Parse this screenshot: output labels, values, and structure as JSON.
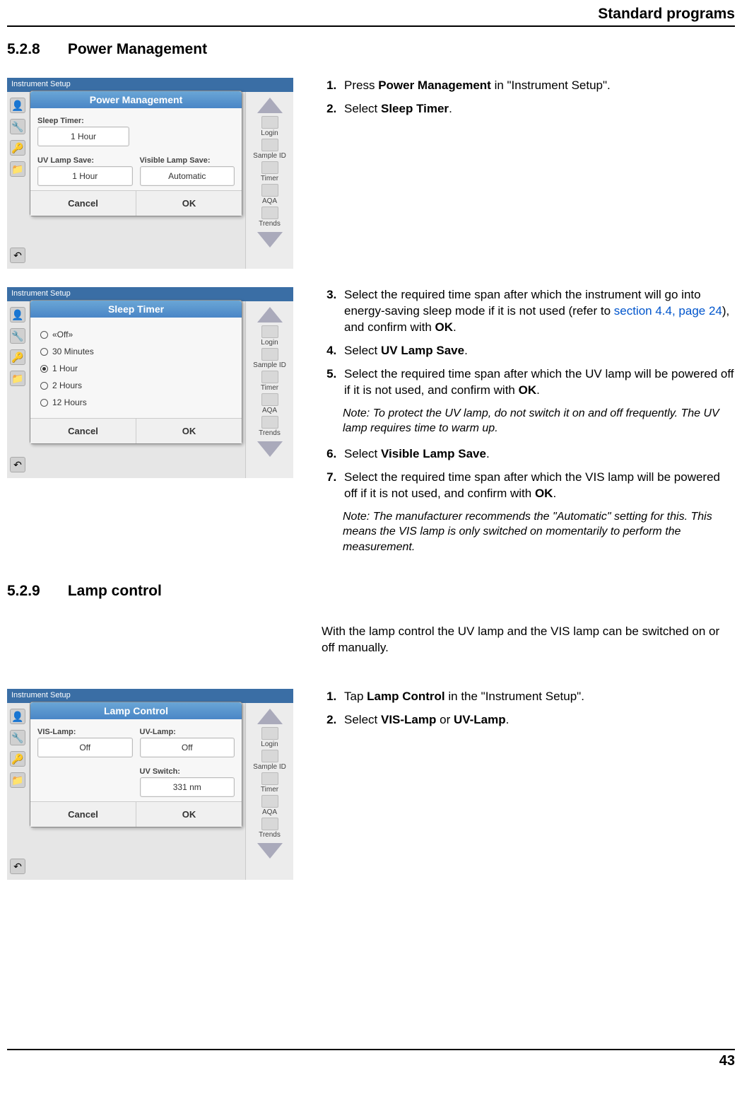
{
  "header": {
    "title": "Standard programs"
  },
  "sections": {
    "s1": {
      "num": "5.2.8",
      "title": "Power Management"
    },
    "s2": {
      "num": "5.2.9",
      "title": "Lamp control"
    }
  },
  "block1": {
    "steps": [
      {
        "pre": "Press ",
        "b": "Power Management",
        "post": " in \"Instrument Setup\"."
      },
      {
        "pre": "Select ",
        "b": "Sleep Timer",
        "post": "."
      }
    ]
  },
  "block2": {
    "step3_a": "Select the required time span after which the instrument will go into energy-saving sleep mode if it is not used (refer to ",
    "step3_link": "section 4.4, page 24",
    "step3_b": "), and confirm with ",
    "step3_bold": "OK",
    "step3_c": ".",
    "step4_pre": "Select ",
    "step4_b": "UV Lamp Save",
    "step4_post": ".",
    "step5_a": "Select the required time span after which the UV lamp will be powered off if it is not used, and confirm with ",
    "step5_b": "OK",
    "step5_c": ".",
    "note1": "Note: To protect the UV lamp, do not switch it on and off frequently. The UV lamp requires time to warm up.",
    "step6_pre": "Select ",
    "step6_b": "Visible Lamp Save",
    "step6_post": ".",
    "step7_a": "Select the required time span after which the VIS lamp will be powered off if it is not used, and confirm with ",
    "step7_b": "OK",
    "step7_c": ".",
    "note2": "Note: The manufacturer recommends the \"Automatic\" setting for this. This means the VIS lamp is only switched on momentarily to perform the measurement."
  },
  "intro2": "With the lamp control the UV lamp and the VIS lamp can be switched on or off manually.",
  "block3": {
    "step1_pre": "Tap ",
    "step1_b": "Lamp Control",
    "step1_post": " in the \"Instrument Setup\".",
    "step2_pre": "Select ",
    "step2_b1": "VIS-Lamp",
    "step2_mid": " or ",
    "step2_b2": "UV-Lamp",
    "step2_post": "."
  },
  "shot_common": {
    "bg_title": "Instrument Setup",
    "side_right": {
      "login": "Login",
      "sample": "Sample ID",
      "timer": "Timer",
      "aqa": "AQA",
      "trends": "Trends"
    },
    "cancel": "Cancel",
    "ok": "OK"
  },
  "shot1": {
    "title": "Power Management",
    "sleep_label": "Sleep Timer:",
    "sleep_val": "1 Hour",
    "uv_label": "UV Lamp Save:",
    "vis_label": "Visible Lamp Save:",
    "uv_val": "1 Hour",
    "vis_val": "Automatic"
  },
  "shot2": {
    "title": "Sleep Timer",
    "options": [
      "«Off»",
      "30 Minutes",
      "1 Hour",
      "2 Hours",
      "12 Hours"
    ],
    "selected_index": 2
  },
  "shot3": {
    "title": "Lamp Control",
    "vis_label": "VIS-Lamp:",
    "uv_label": "UV-Lamp:",
    "vis_val": "Off",
    "uv_val": "Off",
    "switch_label": "UV Switch:",
    "switch_val": "331 nm"
  },
  "footer": {
    "page": "43"
  }
}
